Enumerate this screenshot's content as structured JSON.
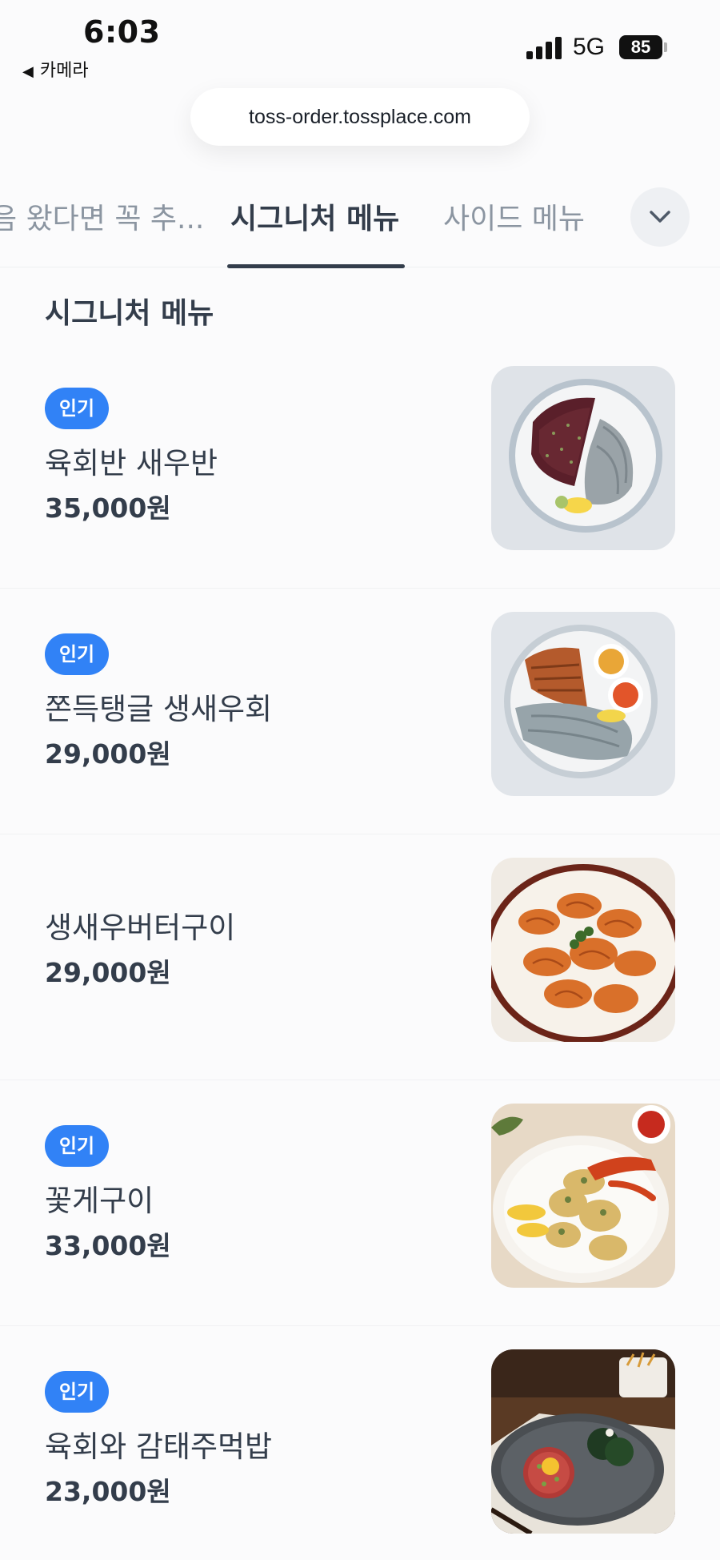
{
  "status_bar": {
    "time": "6:03",
    "back_label": "카메라",
    "back_icon": "triangle-left-icon",
    "network": "5G",
    "battery": "85"
  },
  "browser": {
    "url": "toss-order.tossplace.com"
  },
  "tabs": [
    {
      "label": "음 왔다면 꼭 추...",
      "active": false
    },
    {
      "label": "시그니처 메뉴",
      "active": true
    },
    {
      "label": "사이드 메뉴",
      "active": false
    }
  ],
  "tabs_expand_icon": "chevron-down-icon",
  "section": {
    "title": "시그니처 메뉴"
  },
  "colors": {
    "badge": "#3182f6",
    "text": "#333d4b",
    "inactive_tab": "#8b95a1"
  },
  "menu_items": [
    {
      "badge": "인기",
      "name": "육회반 새우반",
      "price": "35,000원"
    },
    {
      "badge": "인기",
      "name": "쫀득탱글 생새우회",
      "price": "29,000원"
    },
    {
      "badge": "",
      "name": "생새우버터구이",
      "price": "29,000원"
    },
    {
      "badge": "인기",
      "name": "꽃게구이",
      "price": "33,000원"
    },
    {
      "badge": "인기",
      "name": "육회와 감태주먹밥",
      "price": "23,000원"
    }
  ]
}
